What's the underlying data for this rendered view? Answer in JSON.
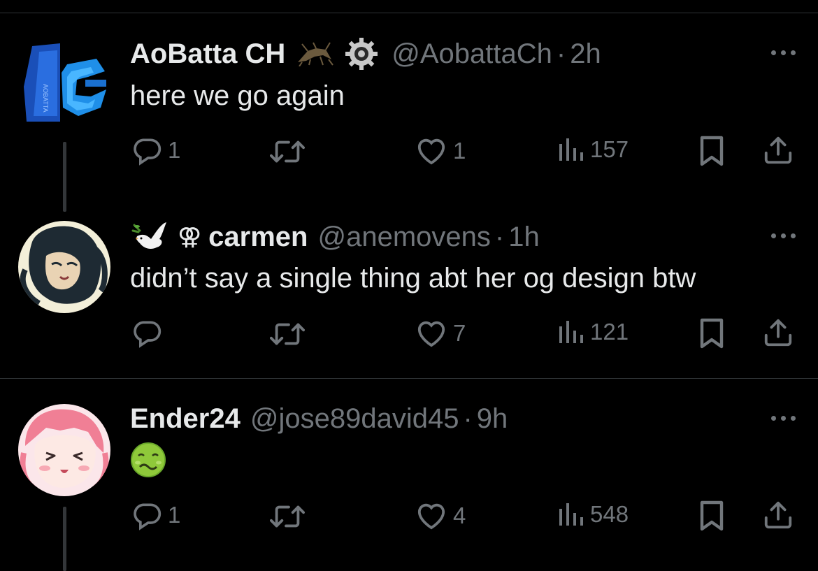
{
  "tweets": [
    {
      "name": "AoBatta CH",
      "handle": "@AobattaCh",
      "time": "2h",
      "text": "here we go again",
      "avatar_text": "AOBATTA",
      "replies": "1",
      "likes": "1",
      "views": "157"
    },
    {
      "name": "carmen",
      "handle": "@anemovens",
      "time": "1h",
      "text": "didn’t say a single thing abt her og design btw",
      "name_prefix": "⚢",
      "replies": "",
      "likes": "7",
      "views": "121"
    },
    {
      "name": "Ender24",
      "handle": "@jose89david45",
      "time": "9h",
      "text": "",
      "emoji": "nauseated-face",
      "replies": "1",
      "likes": "4",
      "views": "548"
    }
  ],
  "separator": "·",
  "colors": {
    "background": "#000000",
    "text": "#e7e9ea",
    "muted": "#71767b",
    "divider": "#2f3336"
  }
}
